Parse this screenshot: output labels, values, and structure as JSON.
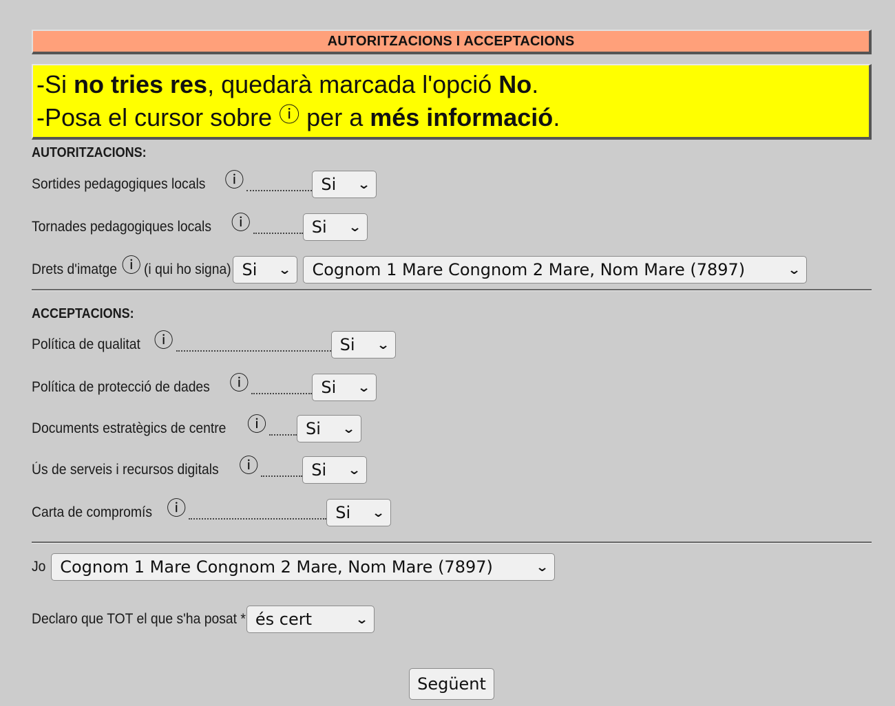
{
  "header": {
    "title": "AUTORITZACIONS I ACCEPTACIONS"
  },
  "notice": {
    "line1": {
      "prefix": "-Si ",
      "bold1": "no tries res",
      "middle": ", quedarà marcada l'opció ",
      "bold2": "No",
      "suffix": "."
    },
    "line2": {
      "prefix": "-Posa el cursor sobre ",
      "icon": "ⓘ",
      "middle": " per a ",
      "bold": "més informació",
      "suffix": "."
    }
  },
  "autoritzacions": {
    "heading": "AUTORITZACIONS:",
    "items": [
      {
        "label": "Sortides pedagogiques locals",
        "value": "Si"
      },
      {
        "label": "Tornades pedagogiques locals",
        "value": "Si"
      },
      {
        "label": "Drets d'imatge",
        "extra": "(i qui ho signa)",
        "value": "Si",
        "signer": "Cognom 1 Mare Congnom 2 Mare, Nom Mare (7897)"
      }
    ]
  },
  "acceptacions": {
    "heading": "ACCEPTACIONS:",
    "items": [
      {
        "label": "Política de qualitat",
        "value": "Si"
      },
      {
        "label": "Política de protecció de dades",
        "value": "Si"
      },
      {
        "label": "Documents estratègics de centre",
        "value": "Si"
      },
      {
        "label": "Ús de serveis i recursos digitals",
        "value": "Si"
      },
      {
        "label": "Carta de compromís",
        "value": "Si"
      }
    ]
  },
  "jo": {
    "label": "Jo",
    "value": "Cognom 1 Mare Congnom 2 Mare, Nom Mare (7897)"
  },
  "declaro": {
    "label": "Declaro que TOT el que s'ha posat *",
    "value": "és cert"
  },
  "next_button": "Següent",
  "icons": {
    "info": "info-circle-icon",
    "dropdown": "chevron-down-icon"
  }
}
